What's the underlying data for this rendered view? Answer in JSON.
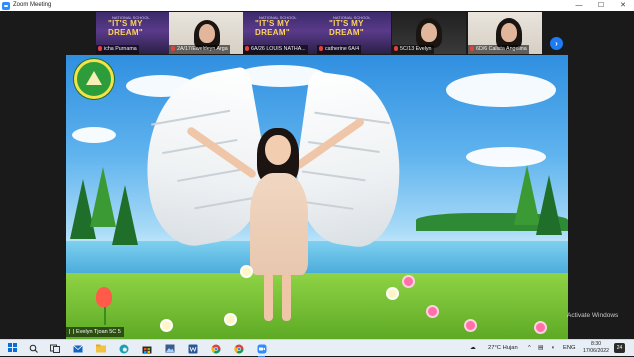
{
  "window": {
    "title": "Zoom Meeting",
    "controls": {
      "minimize": "—",
      "maximize": "☐",
      "close": "✕"
    }
  },
  "gallery": {
    "participants": [
      {
        "name": "icha Purnama",
        "muted": true,
        "tile": "dream-slide",
        "slide_top": "NATIONAL SCHOOL",
        "slide_text": "\"IT'S MY DREAM\""
      },
      {
        "name": "2A/17/Eweldeyn Arga",
        "muted": true,
        "tile": "webcam-room"
      },
      {
        "name": "6A/26 LOUIS NATHA...",
        "muted": true,
        "tile": "dream-slide",
        "slide_top": "NATIONAL SCHOOL",
        "slide_text": "\"IT'S MY DREAM\""
      },
      {
        "name": "catherine 6A/4",
        "muted": true,
        "tile": "dream-slide",
        "slide_top": "NATIONAL SCHOOL",
        "slide_text": "\"IT'S MY DREAM\""
      },
      {
        "name": "5C/13 Evelyn",
        "muted": true,
        "tile": "webcam-dark"
      },
      {
        "name": "6D/6 Calista Angelina",
        "muted": true,
        "tile": "webcam-room"
      }
    ],
    "next_page_icon": "›"
  },
  "stage": {
    "speaker_name": "Evelyn Tjoan 5C 5",
    "watermark": "Activate Windows"
  },
  "taskbar": {
    "apps": [
      "search-icon",
      "task-view-icon",
      "mail-icon",
      "file-explorer-icon",
      "edge-icon",
      "store-icon",
      "word-icon",
      "chrome-icon",
      "zoom-icon"
    ],
    "weather": "27°C  Hujan",
    "language": "ENG",
    "time": "8:30",
    "date": "17/06/2022",
    "notifications": "24"
  }
}
